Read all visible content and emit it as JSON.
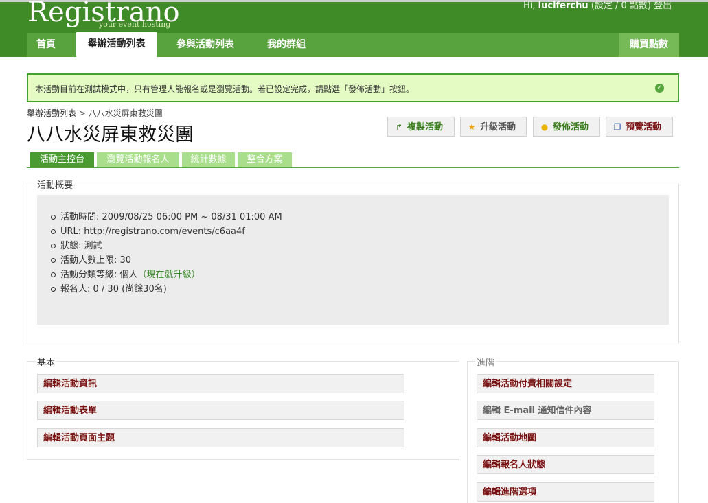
{
  "header": {
    "logo": "Registrano",
    "tagline": "your event hosting",
    "user_greeting": "Hi,",
    "username": "luciferchu",
    "points_text": "(設定 / 0 點數)",
    "logout": "登出"
  },
  "nav": {
    "items": [
      {
        "label": "首頁"
      },
      {
        "label": "舉辦活動列表"
      },
      {
        "label": "參與活動列表"
      },
      {
        "label": "我的群組"
      }
    ],
    "buy_points": "購買點數"
  },
  "notice": {
    "text": "本活動目前在測試模式中，只有管理人能報名或是瀏覽活動。若已設定完成，請點選「發佈活動」按鈕。"
  },
  "breadcrumb": {
    "parent": "舉辦活動列表",
    "separator": ">",
    "current": "八八水災屏東救災團"
  },
  "event": {
    "title": "八八水災屏東救災團"
  },
  "actions": {
    "copy": "複製活動",
    "upgrade": "升級活動",
    "publish": "發佈活動",
    "preview": "預覽活動"
  },
  "tabs": [
    {
      "label": "活動主控台"
    },
    {
      "label": "瀏覽活動報名人"
    },
    {
      "label": "統計數據"
    },
    {
      "label": "整合方案"
    }
  ],
  "overview": {
    "legend": "活動概要",
    "time": "活動時間: 2009/08/25 06:00 PM ~ 08/31 01:00 AM",
    "url": "URL: http://registrano.com/events/c6aa4f",
    "status": "狀態: 測試",
    "capacity": "活動人數上限: 30",
    "tier_prefix": "活動分類等級: 個人",
    "tier_upgrade": "（現在就升級）",
    "registrants": "報名人: 0 / 30 (尚餘30名)"
  },
  "basic": {
    "legend": "基本",
    "links": [
      "編輯活動資訊",
      "編輯活動表單",
      "編輯活動頁面主題"
    ]
  },
  "advanced": {
    "legend": "進階",
    "links": [
      "編輯活動付費相關設定",
      "編輯 E-mail 通知信件內容",
      "編輯活動地圖",
      "編輯報名人狀態",
      "編輯進階選項"
    ]
  },
  "colors": {
    "header_green": "#3e8b28",
    "nav_green": "#58a33e",
    "notice_bg": "#e4fbc4",
    "link_red": "#7a1313"
  }
}
